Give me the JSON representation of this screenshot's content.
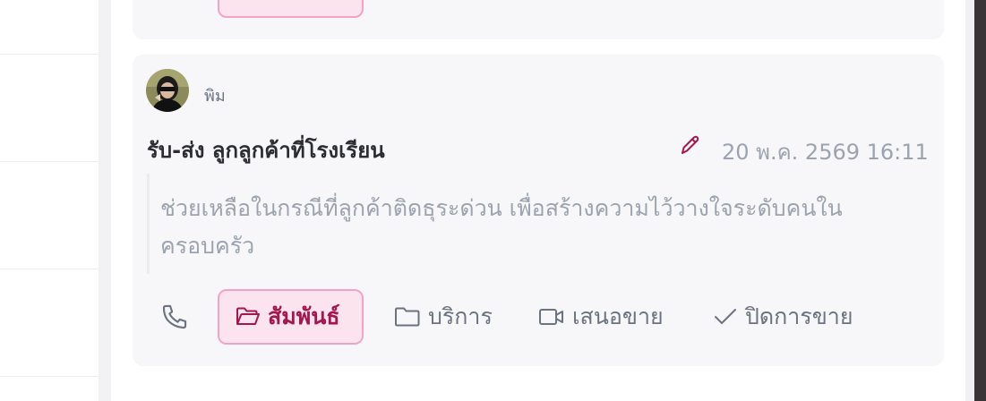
{
  "colors": {
    "accent": "#a3174f",
    "accent_bg": "#fce4ef",
    "accent_border": "#f3a3c6",
    "muted_text": "#9ca3af",
    "card_bg": "#f7f7f9"
  },
  "post": {
    "author": "พิม",
    "avatar_icon": "user-avatar",
    "title": "รับ-ส่ง ลูกลูกค้าที่โรงเรียน",
    "timestamp": "20 พ.ค. 2569 16:11",
    "description": "ช่วยเหลือในกรณีที่ลูกค้าติดธุระด่วน เพื่อสร้างความไว้วางใจระดับคนในครอบครัว",
    "edit_icon": "pencil-icon"
  },
  "actions": [
    {
      "icon": "phone-icon",
      "label": ""
    },
    {
      "icon": "folder-open-icon",
      "label": "สัมพันธ์",
      "active": true
    },
    {
      "icon": "folder-icon",
      "label": "บริการ"
    },
    {
      "icon": "video-icon",
      "label": "เสนอขาย"
    },
    {
      "icon": "check-icon",
      "label": "ปิดการขาย"
    }
  ]
}
